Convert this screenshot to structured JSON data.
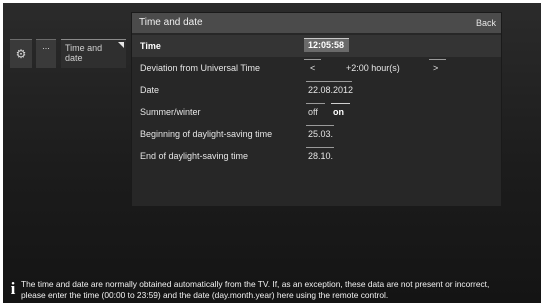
{
  "breadcrumb": {
    "settings_icon": "gear-icon",
    "more_label": "...",
    "current_label": "Time and date"
  },
  "panel": {
    "title": "Time and date",
    "back_label": "Back",
    "rows": {
      "time": {
        "label": "Time",
        "value": "12:05:58"
      },
      "deviation": {
        "label": "Deviation from Universal Time",
        "left_arrow": "<",
        "value": "+2:00 hour(s)",
        "right_arrow": ">"
      },
      "date": {
        "label": "Date",
        "value": "22.08.2012"
      },
      "summer_winter": {
        "label": "Summer/winter",
        "off": "off",
        "on": "on",
        "selected": "on"
      },
      "dst_begin": {
        "label": "Beginning of daylight-saving time",
        "value": "25.03."
      },
      "dst_end": {
        "label": "End of daylight-saving time",
        "value": "28.10."
      }
    }
  },
  "info": {
    "icon": "info-icon",
    "line1": "The time and date are normally obtained automatically from the TV. If, as an exception, these data are not present or incorrect,",
    "line2": "please enter the time (00:00 to 23:59) and the date (day.month.year) here using the remote control."
  },
  "colors": {
    "header": "#4b4b4b",
    "panel": "#272727",
    "time_field": "#6a6a6a",
    "text": "#e6e6e6"
  }
}
